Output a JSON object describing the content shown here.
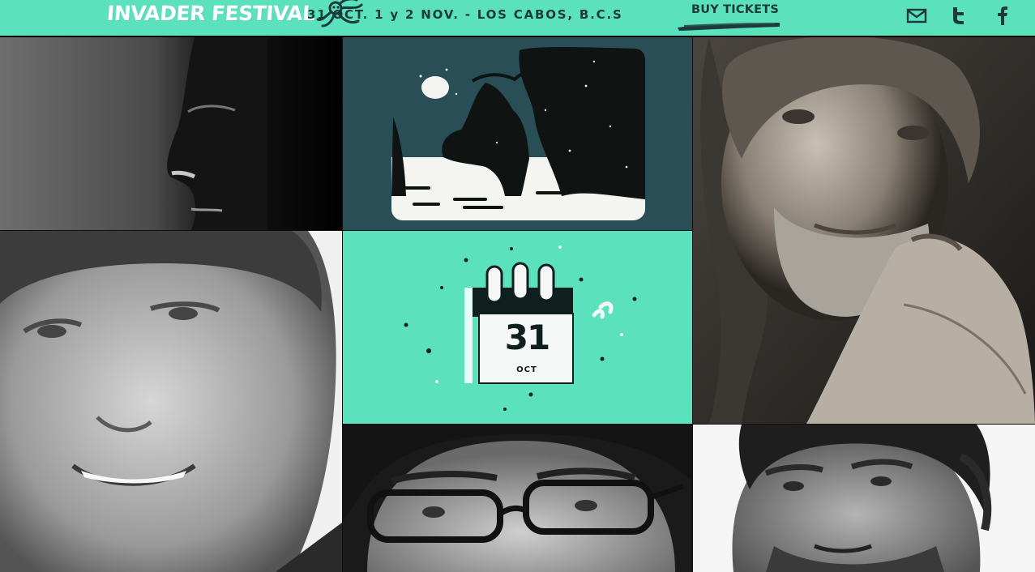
{
  "header": {
    "logo_text": "INVADER FESTIVAL",
    "dates": "31 OCT. 1 y 2 NOV. - LOS CABOS, B.C.S",
    "buy_tickets": "BUY TICKETS"
  },
  "social": [
    "mail-icon",
    "twitter-icon",
    "facebook-icon"
  ],
  "calendar": {
    "day": "31",
    "month": "OCT"
  },
  "colors": {
    "mint": "#5be1bb",
    "dark_teal": "#2a4e55",
    "navy_text": "#1b3a3b"
  }
}
